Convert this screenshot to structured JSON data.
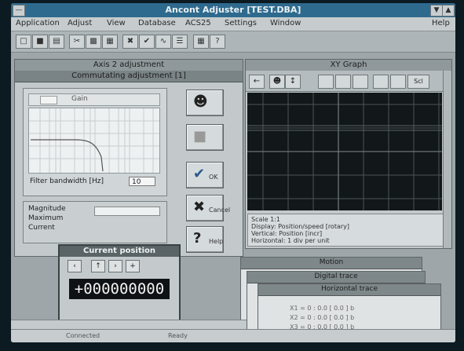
{
  "app": {
    "title": "Ancont Adjuster [TEST.DBA]"
  },
  "menu": [
    "Application",
    "Adjust",
    "View",
    "Database",
    "ACS25",
    "Settings",
    "Window",
    "Help"
  ],
  "toolbar_icons": [
    "open-icon",
    "save-icon",
    "print-icon",
    "cut-icon",
    "copy-icon",
    "paste-icon",
    "cross-icon",
    "check-icon",
    "wave-icon",
    "list-icon",
    "grid-icon",
    "help-icon"
  ],
  "axis_window": {
    "title": "Axis 2 adjustment",
    "subtitle": "Commutating adjustment [1]",
    "tab_label": "Gain",
    "bandwidth_label": "Filter bandwidth [Hz]",
    "bandwidth_value": "10",
    "magnitude_label": "Magnitude",
    "maximum_label": "Maximum",
    "current_label": "Current",
    "magnitude_value": "",
    "maximum_value": "",
    "current_value": "",
    "buttons": [
      {
        "name": "run-button",
        "icon": "☻",
        "label": ""
      },
      {
        "name": "stop-button",
        "icon": "■",
        "label": ""
      },
      {
        "name": "ok-button",
        "icon": "✔",
        "label": "OK"
      },
      {
        "name": "cancel-button",
        "icon": "✖",
        "label": "Cancel"
      },
      {
        "name": "help-button",
        "icon": "?",
        "label": "Help"
      }
    ]
  },
  "xy_window": {
    "title": "XY Graph",
    "toolbar": [
      "←",
      "☻",
      "↕",
      "",
      "",
      "",
      "",
      "",
      "Scl"
    ],
    "info_lines": [
      "Scale 1:1",
      "Display: Position/speed [rotary]",
      "Vertical: Position [incr]",
      "Horizontal: 1 div per unit"
    ]
  },
  "current_position": {
    "title": "Current position",
    "buttons": [
      "‹",
      "↑",
      "›",
      "+"
    ],
    "value": "+000000000"
  },
  "stacked": {
    "w1": "Motion",
    "w2": "Digital trace",
    "w3": "Horizontal trace",
    "lines": [
      "X1 = 0 : 0.0 [ 0.0 ] b",
      "X2 = 0 : 0.0 [ 0.0 ] b",
      "X3 = 0 : 0.0 [ 0.0 ] b"
    ]
  },
  "status_bar": {
    "left": "Connected",
    "right": "Ready"
  }
}
